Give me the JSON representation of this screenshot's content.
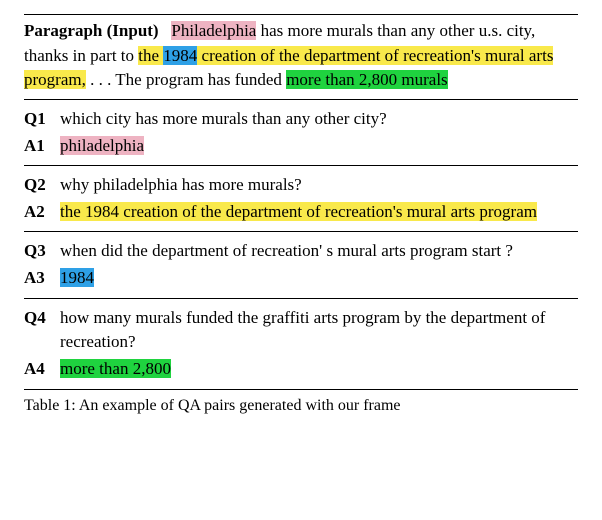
{
  "paragraph": {
    "label": "Paragraph (Input)",
    "pre": "",
    "part1_hl": "Philadelphia",
    "part2": " has more murals than any other u.s. city, thanks in part to ",
    "part3_y1": "the ",
    "part3_blue": "1984",
    "part3_y2": " creation of the department of recreation's mural",
    "part3_y3": " arts program,",
    "part4": " . . . The program has funded ",
    "part5_g1": "more than ",
    "part5_g2": "2,800 murals"
  },
  "qa": [
    {
      "q_label": "Q1",
      "q_text": "which city has more murals than any other city?",
      "a_label": "A1",
      "a_segments": [
        {
          "text": "philadelphia",
          "cls": "hl-pink"
        }
      ]
    },
    {
      "q_label": "Q2",
      "q_text": "why philadelphia has more murals?",
      "a_label": "A2",
      "a_segments": [
        {
          "text": "the 1984 creation of the department of recreation's mural arts program",
          "cls": "hl-yellow"
        }
      ]
    },
    {
      "q_label": "Q3",
      "q_text": "when did the department of recreation' s mural arts program start ?",
      "a_label": "A3",
      "a_segments": [
        {
          "text": "1984",
          "cls": "hl-blue"
        }
      ]
    },
    {
      "q_label": "Q4",
      "q_text": "how many murals funded the graffiti arts program by the department of recreation?",
      "a_label": "A4",
      "a_segments": [
        {
          "text": "more than 2,800",
          "cls": "hl-green"
        }
      ]
    }
  ],
  "caption": "Table 1: An example of QA pairs generated with our frame"
}
